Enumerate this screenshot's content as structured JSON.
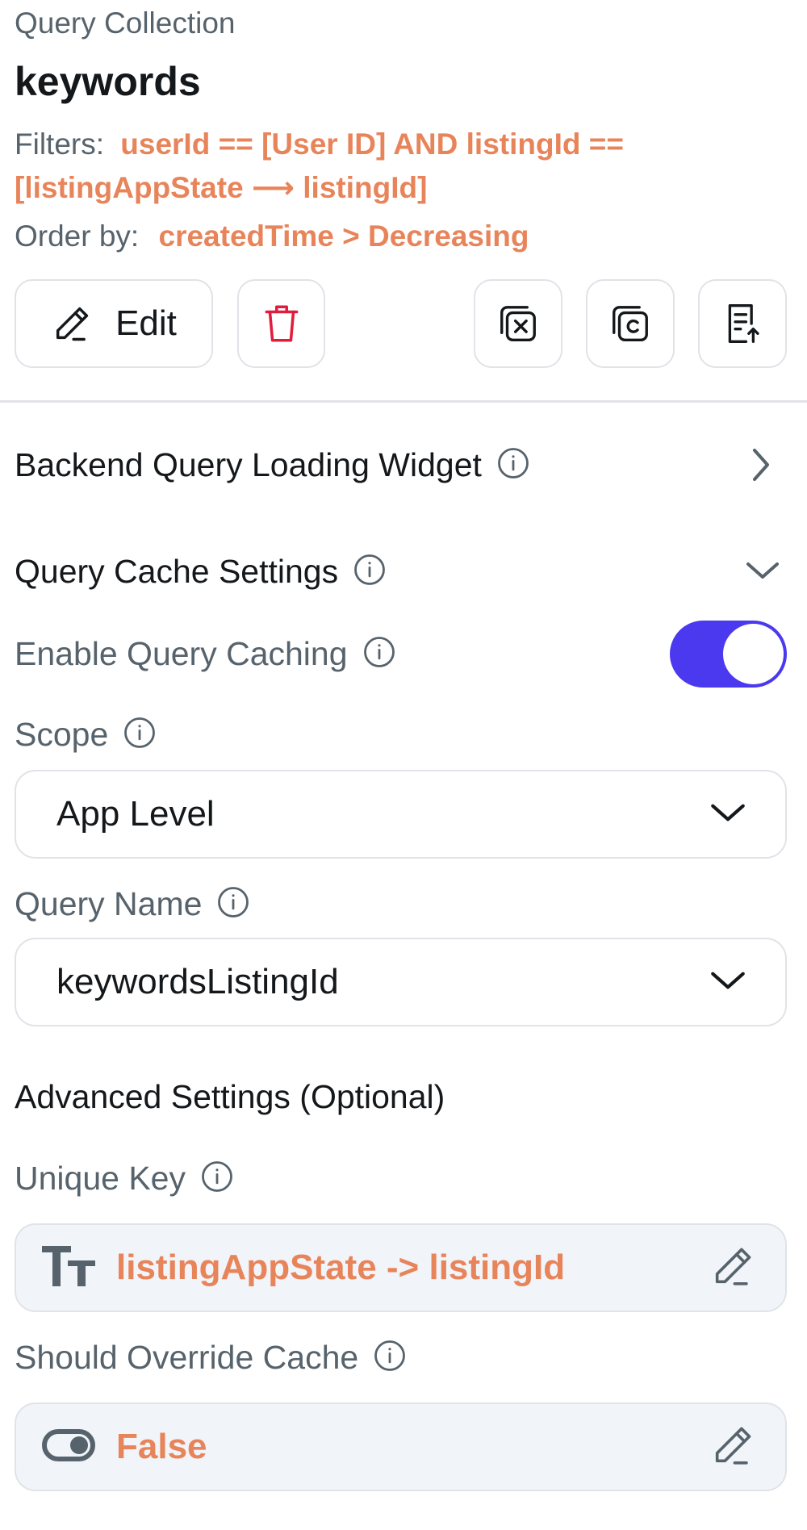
{
  "header": {
    "subtitle": "Query Collection",
    "collection_name": "keywords",
    "filters_label": "Filters:",
    "filters_value": "userId == [User ID] AND listingId ==",
    "filters_value_line2": "[listingAppState ⟶ listingId]",
    "order_label": "Order by:",
    "order_value": "createdTime > Decreasing"
  },
  "toolbar": {
    "edit_label": "Edit",
    "icons": [
      "pencil-icon",
      "trash-icon",
      "clear-variable-icon",
      "copy-icon",
      "export-icon"
    ]
  },
  "backend_loading": {
    "title": "Backend Query Loading Widget"
  },
  "cache_settings": {
    "title": "Query Cache Settings",
    "enable_label": "Enable Query Caching",
    "enable_value": true,
    "scope_label": "Scope",
    "scope_value": "App Level",
    "query_name_label": "Query Name",
    "query_name_value": "keywordsListingId"
  },
  "advanced": {
    "title": "Advanced Settings (Optional)",
    "unique_key_label": "Unique Key",
    "unique_key_value": "listingAppState -> listingId",
    "override_label": "Should Override Cache",
    "override_value": "False"
  },
  "colors": {
    "accent": "#4b39ef",
    "value_orange": "#e8845a",
    "danger": "#e21c3d",
    "border": "#e0e3e7",
    "field_bg": "#f1f4f8"
  }
}
